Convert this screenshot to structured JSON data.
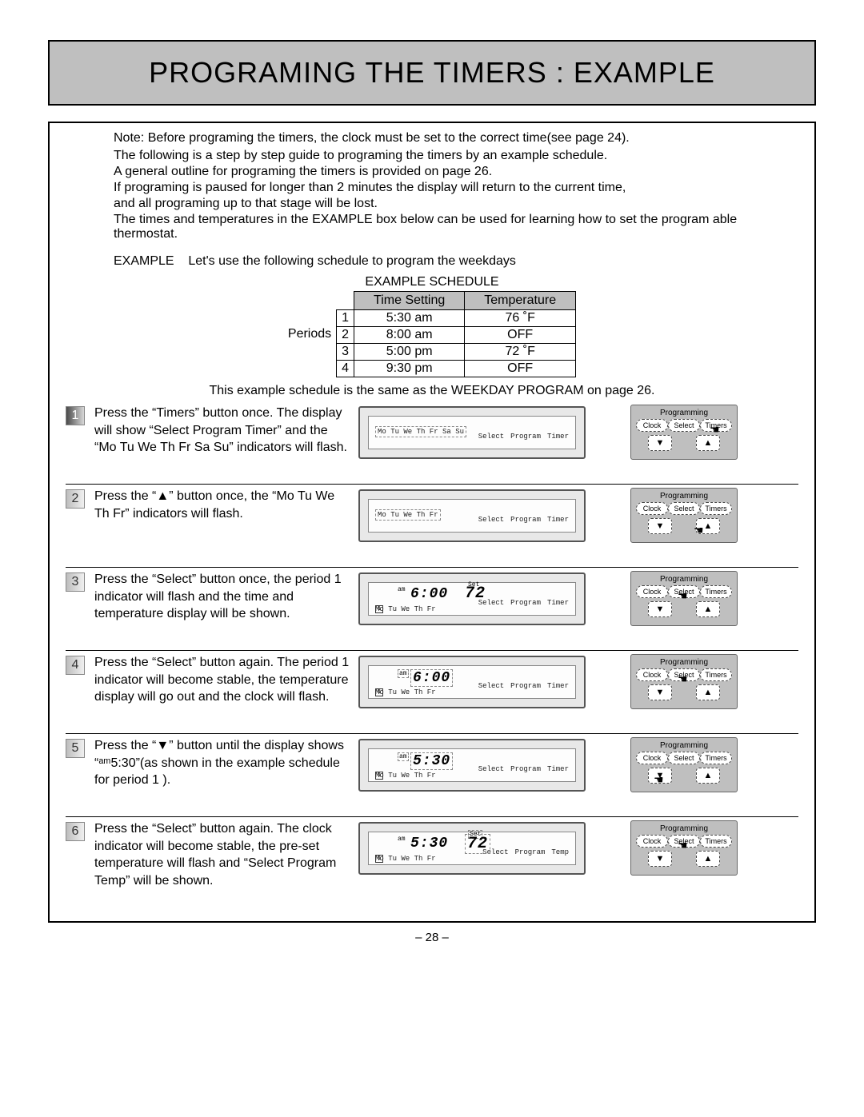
{
  "title": "PROGRAMING THE TIMERS : EXAMPLE",
  "note": "Note: Before programing the timers, the clock must be set to the correct time(see page 24).",
  "intro": [
    "The following is a step by step guide to programing the timers by an example schedule.",
    "A general outline for programing the timers is provided on page 26.",
    "If programing is paused for longer than 2 minutes the display will return to the current time,",
    "and all programing up to that stage will be lost.",
    "The times and temperatures in the EXAMPLE box below can be used for learning how to set the program able thermostat."
  ],
  "example_line_label": "EXAMPLE",
  "example_line_text": "Let's use the following schedule to program the weekdays",
  "schedule": {
    "caption": "EXAMPLE SCHEDULE",
    "periods_label": "Periods",
    "headers": [
      "Time Setting",
      "Temperature"
    ],
    "rows": [
      {
        "n": "1",
        "time": "5:30 am",
        "temp": "76 ˚F"
      },
      {
        "n": "2",
        "time": "8:00 am",
        "temp": "OFF"
      },
      {
        "n": "3",
        "time": "5:00 pm",
        "temp": "72 ˚F"
      },
      {
        "n": "4",
        "time": "9:30 pm",
        "temp": "OFF"
      }
    ],
    "note": "This example schedule is the same as the WEEKDAY PROGRAM on page 26."
  },
  "controls": {
    "heading": "Programming",
    "clock": "Clock",
    "select": "Select",
    "timers": "Timers",
    "down": "▼",
    "up": "▲"
  },
  "lcd_common": {
    "labels_select": "Select",
    "labels_program": "Program",
    "labels_timer": "Timer",
    "labels_temp": "Temp",
    "days_full": "Mo Tu We Th Fr Sa Su",
    "days_wk": "Mo Tu We Th Fr",
    "am": "am",
    "set": "Set"
  },
  "steps": [
    {
      "num": "1",
      "text": "Press the  “Timers” button once. The display will show “Select Program Timer” and the “Mo Tu We Th Fr Sa Su” indicators will flash.",
      "lcd": {
        "days": "full",
        "days_dash": true,
        "time": "",
        "labels": [
          "select",
          "program",
          "timer"
        ]
      },
      "hand": "timers"
    },
    {
      "num": "2",
      "text": "Press the “▲” button once, the “Mo Tu We Th Fr” indicators will flash.",
      "lcd": {
        "days": "wk_dash_mid",
        "time": "",
        "labels": [
          "select",
          "program",
          "timer"
        ]
      },
      "hand": "up"
    },
    {
      "num": "3",
      "text": "Press the “Select” button once, the period 1 indicator will flash and the time and temperature display will be shown.",
      "lcd": {
        "days": "wk_low",
        "time": "6:00",
        "am": true,
        "temp": "72",
        "set": true,
        "period": "1",
        "period_dash": false,
        "labels": [
          "select",
          "program",
          "timer"
        ]
      },
      "hand": "select"
    },
    {
      "num": "4",
      "text": "Press the “Select” button again. The period 1 indicator will become stable, the temperature display will go out and the clock will flash.",
      "lcd": {
        "days": "wk_low",
        "time": "6:00",
        "time_dash": true,
        "am": true,
        "am_dash": true,
        "period": "1",
        "labels": [
          "select",
          "program",
          "timer"
        ]
      },
      "hand": "select"
    },
    {
      "num": "5",
      "text": "Press the “▼” button until the display shows “ᵃᵐ5:30”(as shown in the example schedule for period 1 ).",
      "lcd": {
        "days": "wk_low",
        "time": "5:30",
        "time_dash": true,
        "am": true,
        "am_dash": true,
        "period": "1",
        "labels": [
          "select",
          "program",
          "timer"
        ]
      },
      "hand": "down"
    },
    {
      "num": "6",
      "text": "Press the “Select” button again. The clock indicator will become stable, the pre-set temperature will flash and “Select Program Temp” will be shown.",
      "lcd": {
        "days": "wk_low",
        "time": "5:30",
        "am": true,
        "temp": "72",
        "temp_dash": true,
        "set": true,
        "set_dash": true,
        "period": "1",
        "labels": [
          "select",
          "program",
          "temp"
        ]
      },
      "hand": "select"
    }
  ],
  "page_number": "– 28 –"
}
